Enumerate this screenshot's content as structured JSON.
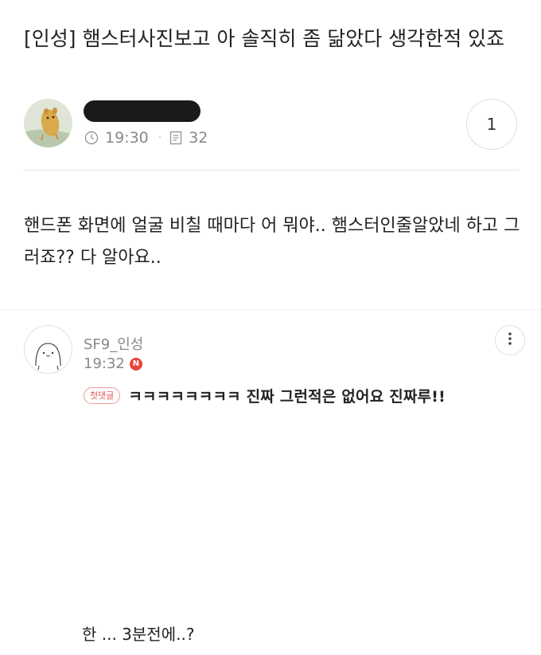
{
  "post": {
    "title": "[인성] 햄스터사진보고 아 솔직히 좀 닮았다 생각한적 있죠",
    "time": "19:30",
    "views": "32",
    "comment_count": "1",
    "body": "핸드폰 화면에 얼굴 비칠 때마다 어 뭐야.. 햄스터인줄알았네 하고 그러죠?? 다 알아요.."
  },
  "comment": {
    "author": "SF9_인성",
    "time": "19:32",
    "new_badge": "N",
    "first_comment_badge": "첫댓글",
    "text": "ㅋㅋㅋㅋㅋㅋㅋㅋ 진짜 그런적은 없어요 진짜루!!"
  },
  "caption": "한 ... 3분전에..?",
  "icons": {
    "time": "clock-icon",
    "views": "document-icon",
    "more": "more-vertical-icon",
    "avatar_author": "hamster-avatar",
    "avatar_commenter": "cute-face-avatar"
  },
  "colors": {
    "text": "#222222",
    "muted": "#888888",
    "new_badge": "#e8453c",
    "first_comment_badge": "#e05656",
    "divider": "#e4e4e4"
  }
}
